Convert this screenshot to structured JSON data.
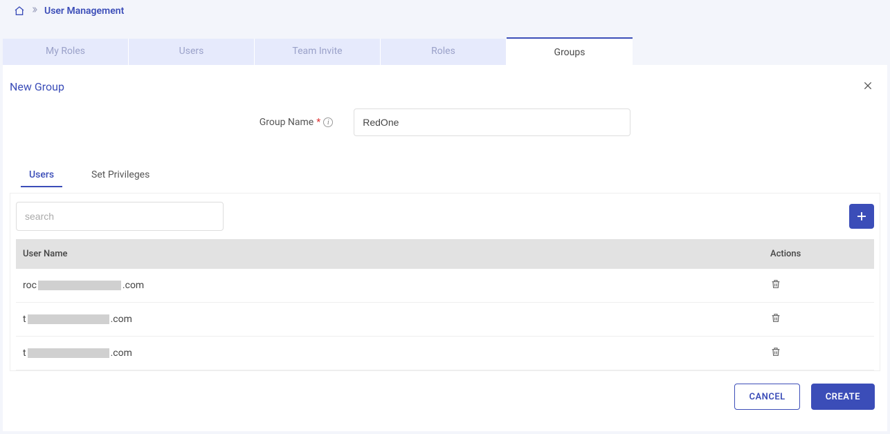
{
  "breadcrumb": {
    "current": "User Management"
  },
  "main_tabs": [
    {
      "label": "My Roles"
    },
    {
      "label": "Users"
    },
    {
      "label": "Team Invite"
    },
    {
      "label": "Roles"
    },
    {
      "label": "Groups"
    }
  ],
  "panel": {
    "title": "New Group"
  },
  "form": {
    "group_name_label": "Group Name",
    "group_name_value": "RedOne"
  },
  "sub_tabs": [
    {
      "label": "Users"
    },
    {
      "label": "Set Privileges"
    }
  ],
  "search": {
    "placeholder": "search",
    "value": ""
  },
  "table": {
    "columns": {
      "user": "User Name",
      "actions": "Actions"
    },
    "rows": [
      {
        "prefix": "roc",
        "redact_w": 120,
        "suffix": ".com"
      },
      {
        "prefix": "t",
        "redact_w": 118,
        "suffix": ".com"
      },
      {
        "prefix": "t",
        "redact_w": 118,
        "suffix": ".com"
      }
    ]
  },
  "buttons": {
    "cancel": "CANCEL",
    "create": "CREATE"
  }
}
